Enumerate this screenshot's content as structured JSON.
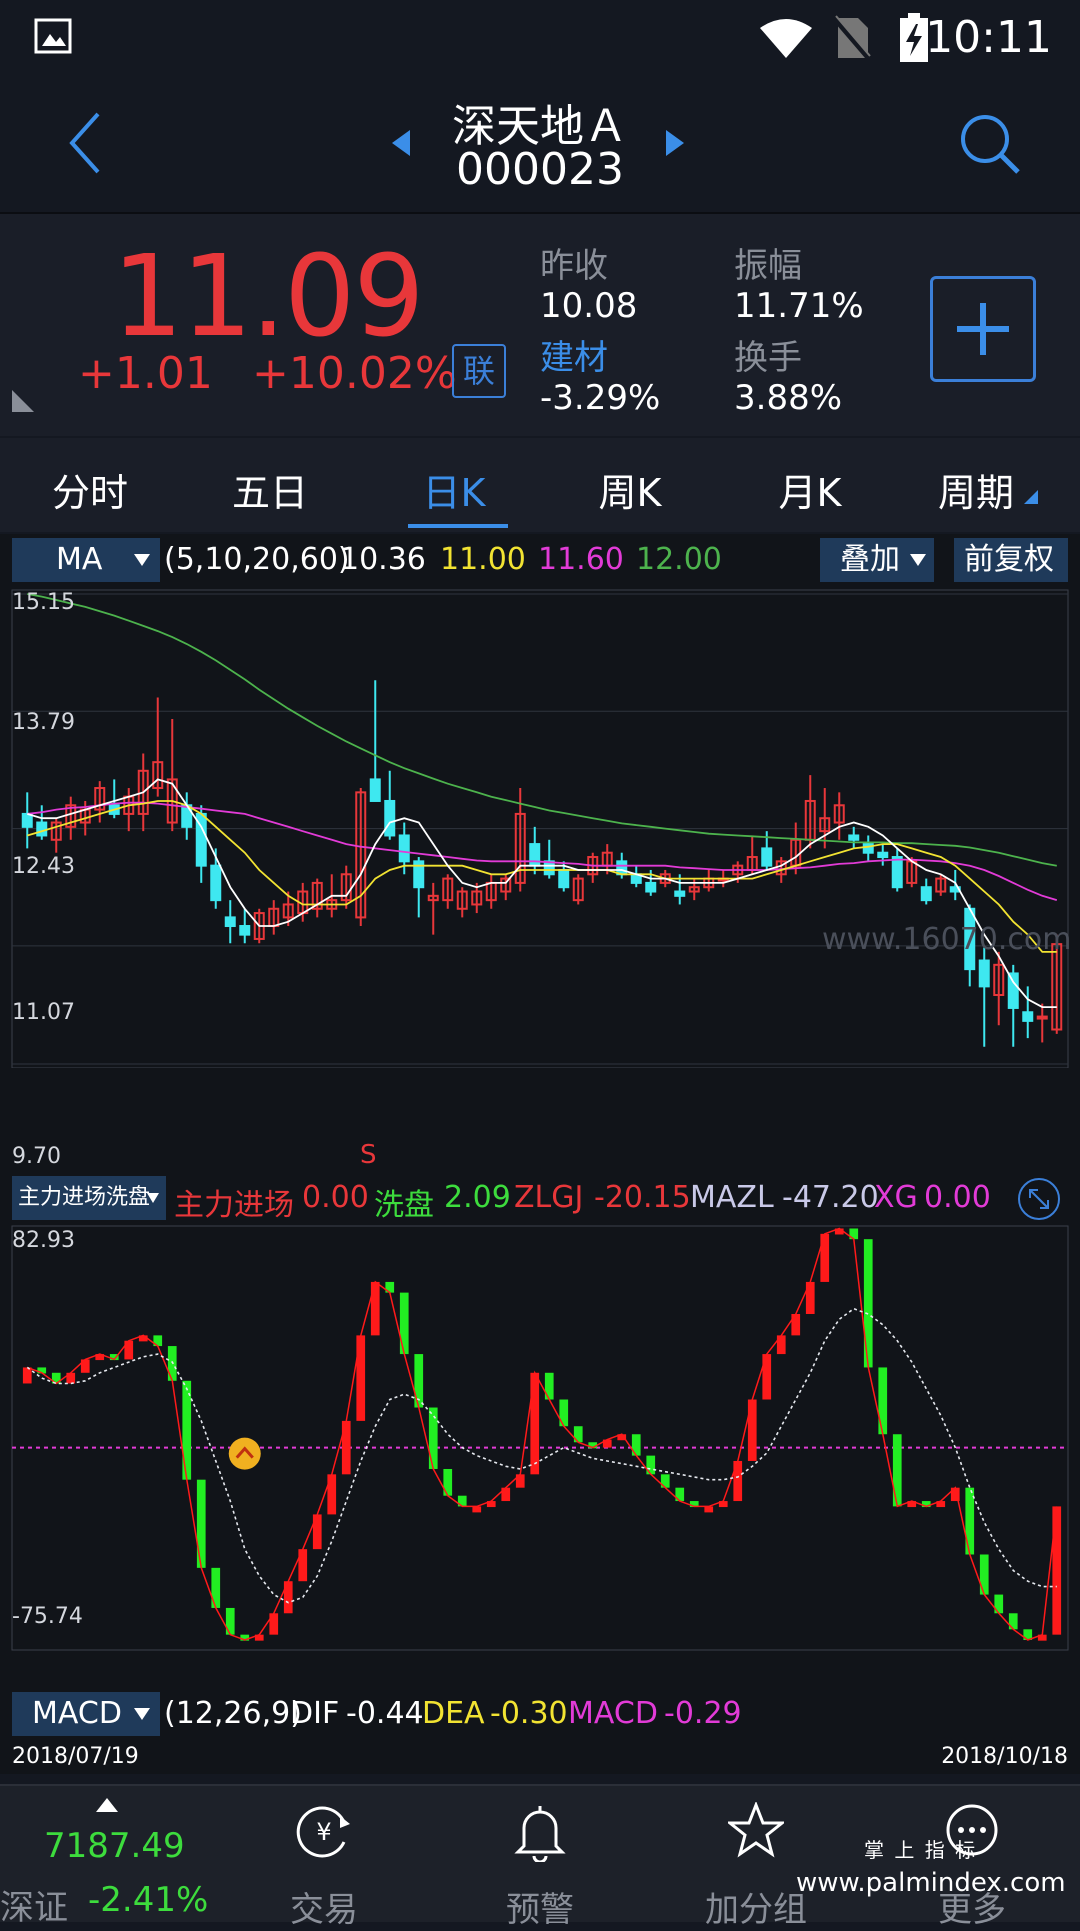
{
  "status_bar": {
    "time": "10:11"
  },
  "header": {
    "stock_name": "深天地Ａ",
    "stock_code": "000023"
  },
  "quote": {
    "price": "11.09",
    "change": "+1.01",
    "change_pct": "+10.02%",
    "lian_label": "联",
    "prev_close_label": "昨收",
    "prev_close": "10.08",
    "amplitude_label": "振幅",
    "amplitude": "11.71%",
    "sector_label": "建材",
    "sector_pct": "-3.29%",
    "turnover_label": "换手",
    "turnover": "3.88%"
  },
  "tabs": [
    "分时",
    "五日",
    "日K",
    "周K",
    "月K",
    "周期"
  ],
  "active_tab": 2,
  "ma_bar": {
    "dropdown": "MA",
    "params": "(5,10,20,60)",
    "v5": "10.36",
    "v10": "11.00",
    "v20": "11.60",
    "v60": "12.00",
    "overlay_btn": "叠加",
    "adjust_btn": "前复权",
    "colors": {
      "ma5": "#ffffff",
      "ma10": "#f2e332",
      "ma20": "#e23bd7",
      "ma60": "#4db34d",
      "up": "#e8373a",
      "down": "#3ee8f0"
    }
  },
  "ma_watermark": "www.16070.com",
  "sell_marker": "S",
  "indicator_bar": {
    "dropdown": "主力进场洗盘",
    "zljc_label": "主力进场",
    "zljc_val": "0.00",
    "xp_label": "洗盘",
    "xp_val": "2.09",
    "zlgj_label": "ZLGJ",
    "zlgj_val": "-20.15",
    "mazl_label": "MAZL",
    "mazl_val": "-47.20",
    "xg_label": "XG",
    "xg_val": "0.00"
  },
  "macd_bar": {
    "dropdown": "MACD",
    "params": "(12,26,9)",
    "dif_label": "DIF",
    "dif_val": "-0.44",
    "dea_label": "DEA",
    "dea_val": "-0.30",
    "macd_label": "MACD",
    "macd_val": "-0.29"
  },
  "dates": {
    "start": "2018/07/19",
    "end": "2018/10/18"
  },
  "bottom_nav": {
    "index_value": "7187.49",
    "index_name": "深证",
    "index_pct": "-2.41%",
    "items": [
      "交易",
      "预警",
      "加分组",
      "更多"
    ]
  },
  "watermark": {
    "line1": "掌 上 指 标",
    "line2": "www.palmindex.com"
  },
  "chart_data": [
    {
      "type": "candlestick",
      "y_ticks": [
        "15.15",
        "13.79",
        "12.43",
        "11.07",
        "9.70"
      ],
      "ylim": [
        9.7,
        15.15
      ],
      "ohlc": [
        [
          12.6,
          12.85,
          12.2,
          12.45
        ],
        [
          12.5,
          12.7,
          12.3,
          12.35
        ],
        [
          12.3,
          12.55,
          12.15,
          12.5
        ],
        [
          12.45,
          12.8,
          12.3,
          12.7
        ],
        [
          12.5,
          12.75,
          12.35,
          12.65
        ],
        [
          12.65,
          12.98,
          12.5,
          12.9
        ],
        [
          12.7,
          13.0,
          12.55,
          12.6
        ],
        [
          12.6,
          12.9,
          12.4,
          12.8
        ],
        [
          12.6,
          13.3,
          12.4,
          13.1
        ],
        [
          12.9,
          13.95,
          12.8,
          13.2
        ],
        [
          12.5,
          13.7,
          12.4,
          13.0
        ],
        [
          12.7,
          12.85,
          12.3,
          12.45
        ],
        [
          12.6,
          12.7,
          11.8,
          12.0
        ],
        [
          12.0,
          12.2,
          11.5,
          11.6
        ],
        [
          11.4,
          11.6,
          11.1,
          11.3
        ],
        [
          11.3,
          11.5,
          11.1,
          11.2
        ],
        [
          11.15,
          11.5,
          11.1,
          11.45
        ],
        [
          11.3,
          11.6,
          11.2,
          11.5
        ],
        [
          11.4,
          11.7,
          11.3,
          11.55
        ],
        [
          11.45,
          11.8,
          11.35,
          11.7
        ],
        [
          11.5,
          11.85,
          11.4,
          11.8
        ],
        [
          11.5,
          11.9,
          11.4,
          11.6
        ],
        [
          11.6,
          12.0,
          11.5,
          11.9
        ],
        [
          11.4,
          12.9,
          11.3,
          12.85
        ],
        [
          13.0,
          14.15,
          12.9,
          12.75
        ],
        [
          12.75,
          13.1,
          12.3,
          12.35
        ],
        [
          12.35,
          12.5,
          11.9,
          12.05
        ],
        [
          12.05,
          12.1,
          11.4,
          11.75
        ],
        [
          11.6,
          11.8,
          11.2,
          11.65
        ],
        [
          11.6,
          11.9,
          11.5,
          11.85
        ],
        [
          11.5,
          11.75,
          11.4,
          11.7
        ],
        [
          11.55,
          11.8,
          11.45,
          11.7
        ],
        [
          11.6,
          11.9,
          11.5,
          11.8
        ],
        [
          11.7,
          11.9,
          11.6,
          11.85
        ],
        [
          11.8,
          12.9,
          11.7,
          12.6
        ],
        [
          12.25,
          12.45,
          11.9,
          12.0
        ],
        [
          12.05,
          12.3,
          11.85,
          11.9
        ],
        [
          11.95,
          12.05,
          11.7,
          11.75
        ],
        [
          11.6,
          11.9,
          11.55,
          11.85
        ],
        [
          11.9,
          12.15,
          11.8,
          12.1
        ],
        [
          12.0,
          12.25,
          11.9,
          12.15
        ],
        [
          12.05,
          12.15,
          11.85,
          11.9
        ],
        [
          11.9,
          12.0,
          11.75,
          11.8
        ],
        [
          11.8,
          11.95,
          11.65,
          11.7
        ],
        [
          11.8,
          11.95,
          11.75,
          11.9
        ],
        [
          11.7,
          11.9,
          11.55,
          11.65
        ],
        [
          11.7,
          11.85,
          11.6,
          11.75
        ],
        [
          11.75,
          11.95,
          11.7,
          11.85
        ],
        [
          11.85,
          11.95,
          11.75,
          11.85
        ],
        [
          11.9,
          12.05,
          11.8,
          12.0
        ],
        [
          11.95,
          12.35,
          11.9,
          12.1
        ],
        [
          12.2,
          12.4,
          11.95,
          12.0
        ],
        [
          11.9,
          12.1,
          11.8,
          12.05
        ],
        [
          12.0,
          12.5,
          11.9,
          12.3
        ],
        [
          12.3,
          13.05,
          12.2,
          12.75
        ],
        [
          12.4,
          12.9,
          12.2,
          12.55
        ],
        [
          12.5,
          12.85,
          12.3,
          12.7
        ],
        [
          12.35,
          12.45,
          12.2,
          12.3
        ],
        [
          12.25,
          12.35,
          12.05,
          12.15
        ],
        [
          12.15,
          12.25,
          12.0,
          12.1
        ],
        [
          12.1,
          12.2,
          11.7,
          11.75
        ],
        [
          11.8,
          12.1,
          11.75,
          12.05
        ],
        [
          11.75,
          11.85,
          11.55,
          11.6
        ],
        [
          11.7,
          11.9,
          11.65,
          11.85
        ],
        [
          11.75,
          11.95,
          11.6,
          11.7
        ],
        [
          11.5,
          11.55,
          10.6,
          10.8
        ],
        [
          10.9,
          11.05,
          9.9,
          10.6
        ],
        [
          10.5,
          11.0,
          10.15,
          10.85
        ],
        [
          10.75,
          10.85,
          9.9,
          10.35
        ],
        [
          10.3,
          10.6,
          10.0,
          10.2
        ],
        [
          10.25,
          10.4,
          9.95,
          10.25
        ],
        [
          10.1,
          11.2,
          10.05,
          11.09
        ]
      ],
      "ma5": [
        12.6,
        12.55,
        12.55,
        12.6,
        12.65,
        12.7,
        12.75,
        12.8,
        12.85,
        13.0,
        12.95,
        12.7,
        12.45,
        12.1,
        11.75,
        11.5,
        11.3,
        11.3,
        11.35,
        11.45,
        11.55,
        11.65,
        11.65,
        11.9,
        12.25,
        12.5,
        12.55,
        12.5,
        12.25,
        12.0,
        11.8,
        11.75,
        11.8,
        11.8,
        12.0,
        12.0,
        12.0,
        12.0,
        11.95,
        11.95,
        11.95,
        11.95,
        11.9,
        11.85,
        11.85,
        11.8,
        11.8,
        11.8,
        11.8,
        11.85,
        11.9,
        11.95,
        12.0,
        12.1,
        12.25,
        12.35,
        12.45,
        12.5,
        12.45,
        12.35,
        12.2,
        12.05,
        11.95,
        11.9,
        11.8,
        11.5,
        11.2,
        10.95,
        10.65,
        10.45,
        10.36,
        10.36
      ],
      "ma10": [
        12.35,
        12.4,
        12.45,
        12.5,
        12.55,
        12.6,
        12.65,
        12.7,
        12.72,
        12.75,
        12.75,
        12.7,
        12.6,
        12.45,
        12.3,
        12.15,
        11.95,
        11.8,
        11.65,
        11.55,
        11.55,
        11.55,
        11.55,
        11.65,
        11.85,
        11.95,
        12.0,
        12.0,
        12.0,
        12.0,
        12.0,
        11.95,
        11.9,
        11.9,
        11.95,
        11.95,
        11.95,
        11.95,
        11.95,
        11.95,
        11.95,
        11.9,
        11.9,
        11.9,
        11.85,
        11.85,
        11.85,
        11.85,
        11.85,
        11.85,
        11.85,
        11.9,
        11.95,
        12.0,
        12.05,
        12.1,
        12.15,
        12.2,
        12.22,
        12.25,
        12.25,
        12.2,
        12.15,
        12.1,
        12.0,
        11.85,
        11.7,
        11.55,
        11.35,
        11.2,
        11.0,
        11.0
      ],
      "ma20": [
        12.6,
        12.62,
        12.65,
        12.67,
        12.68,
        12.7,
        12.72,
        12.73,
        12.73,
        12.72,
        12.7,
        12.68,
        12.66,
        12.64,
        12.62,
        12.6,
        12.55,
        12.5,
        12.45,
        12.4,
        12.35,
        12.3,
        12.25,
        12.22,
        12.2,
        12.18,
        12.16,
        12.14,
        12.12,
        12.1,
        12.08,
        12.06,
        12.05,
        12.05,
        12.05,
        12.05,
        12.04,
        12.03,
        12.02,
        12.0,
        12.0,
        12.0,
        12.0,
        12.0,
        12.0,
        11.98,
        11.97,
        11.96,
        11.95,
        11.95,
        11.95,
        11.95,
        11.96,
        11.97,
        11.98,
        12.0,
        12.02,
        12.03,
        12.05,
        12.06,
        12.07,
        12.07,
        12.06,
        12.05,
        12.03,
        12.0,
        11.95,
        11.88,
        11.8,
        11.72,
        11.65,
        11.6
      ],
      "ma60": [
        15.15,
        15.12,
        15.08,
        15.04,
        15.0,
        14.95,
        14.9,
        14.84,
        14.78,
        14.72,
        14.65,
        14.57,
        14.48,
        14.38,
        14.27,
        14.16,
        14.04,
        13.93,
        13.82,
        13.72,
        13.62,
        13.53,
        13.44,
        13.36,
        13.28,
        13.2,
        13.13,
        13.07,
        13.01,
        12.95,
        12.9,
        12.85,
        12.8,
        12.76,
        12.72,
        12.68,
        12.64,
        12.61,
        12.58,
        12.55,
        12.52,
        12.49,
        12.47,
        12.45,
        12.43,
        12.41,
        12.39,
        12.37,
        12.36,
        12.35,
        12.34,
        12.33,
        12.32,
        12.31,
        12.3,
        12.29,
        12.28,
        12.27,
        12.27,
        12.27,
        12.26,
        12.26,
        12.25,
        12.24,
        12.23,
        12.21,
        12.18,
        12.15,
        12.11,
        12.07,
        12.03,
        12.0
      ]
    },
    {
      "type": "bar",
      "y_ticks": [
        "82.93",
        "-75.74"
      ],
      "ylim": [
        -75.74,
        82.93
      ],
      "values": [
        30,
        28,
        24,
        28,
        33,
        35,
        33,
        40,
        42,
        38,
        25,
        -12,
        -45,
        -60,
        -70,
        -72,
        -70,
        -62,
        -50,
        -38,
        -25,
        -10,
        10,
        42,
        62,
        58,
        35,
        15,
        -8,
        -18,
        -22,
        -22,
        -20,
        -15,
        -10,
        28,
        18,
        8,
        2,
        0,
        3,
        5,
        -3,
        -10,
        -15,
        -20,
        -22,
        -22,
        -20,
        -5,
        18,
        35,
        42,
        50,
        62,
        80,
        82,
        78,
        30,
        5,
        -22,
        -20,
        -22,
        -20,
        -15,
        -40,
        -55,
        -62,
        -68,
        -72,
        -70,
        -22
      ],
      "dashed_avg": [
        30,
        26,
        24,
        24,
        25,
        28,
        30,
        32,
        34,
        35,
        32,
        22,
        10,
        -5,
        -20,
        -38,
        -48,
        -55,
        -58,
        -56,
        -48,
        -35,
        -20,
        -5,
        8,
        18,
        20,
        18,
        12,
        5,
        0,
        -3,
        -5,
        -7,
        -8,
        -6,
        -3,
        0,
        -2,
        -4,
        -5,
        -6,
        -7,
        -8,
        -9,
        -10,
        -11,
        -12,
        -12,
        -11,
        -7,
        -2,
        8,
        18,
        28,
        40,
        48,
        52,
        50,
        46,
        40,
        32,
        22,
        12,
        0,
        -15,
        -28,
        -38,
        -46,
        -50,
        -52,
        -52
      ],
      "ref_line": 0
    }
  ]
}
